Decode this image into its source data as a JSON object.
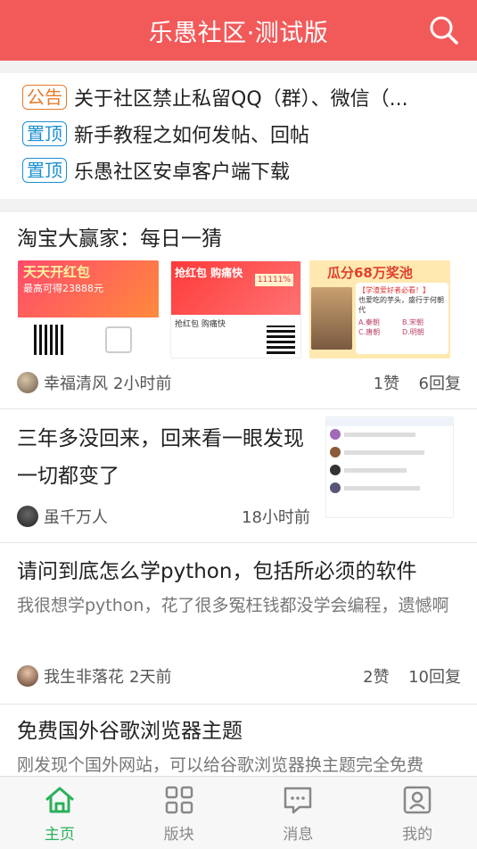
{
  "header": {
    "title": "乐愚社区·测试版",
    "search_icon": "search-icon"
  },
  "notices": [
    {
      "tag": "公告",
      "tag_color": "#e57a2a",
      "text": "关于社区禁止私留QQ（群）、微信（..."
    },
    {
      "tag": "置顶",
      "tag_color": "#1a8fd1",
      "text": "新手教程之如何发帖、回帖"
    },
    {
      "tag": "置顶",
      "tag_color": "#1a8fd1",
      "text": "乐愚社区安卓客户端下载"
    }
  ],
  "posts": [
    {
      "title": "淘宝大赢家：每日一猜",
      "images": [
        {
          "line1": "天天开红包",
          "line2": "最高可得23888元"
        },
        {
          "line1": "抢红包 购痛快",
          "line2": "11111%",
          "sub": "抢红包 购痛快"
        },
        {
          "line1": "瓜分68万奖池",
          "q": "【学渣爱好者必看！】",
          "q2": "也爱吃的芋头，盛行于何朝代",
          "opts": [
            "A.秦朝",
            "B.宋朝",
            "C.唐朝",
            "D.明朝"
          ]
        }
      ],
      "author": "幸福清风",
      "time": "2小时前",
      "likes": "1赞",
      "replies": "6回复"
    },
    {
      "title": "三年多没回来，回来看一眼发现一切都变了",
      "author": "虽千万人",
      "time": "18小时前"
    },
    {
      "title": "请问到底怎么学python，包括所必须的软件",
      "excerpt": "我很想学python，花了很多冤枉钱都没学会编程，遗憾啊",
      "author": "我生非落花",
      "time": "2天前",
      "likes": "2赞",
      "replies": "10回复"
    },
    {
      "title": "免费国外谷歌浏览器主题",
      "excerpt": "刚发现个国外网站，可以给谷歌浏览器换主题完全免费"
    }
  ],
  "tabs": [
    {
      "label": "主页",
      "icon": "home-icon",
      "active": true
    },
    {
      "label": "版块",
      "icon": "grid-icon",
      "active": false
    },
    {
      "label": "消息",
      "icon": "message-icon",
      "active": false
    },
    {
      "label": "我的",
      "icon": "profile-icon",
      "active": false
    }
  ],
  "colors": {
    "header_bg": "#f25a5a",
    "active_tab": "#2bb05a"
  }
}
